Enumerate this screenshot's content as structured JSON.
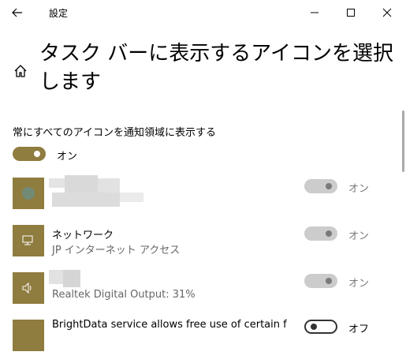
{
  "window": {
    "title": "設定"
  },
  "page": {
    "title": "タスク バーに表示するアイコンを選択します"
  },
  "always_show": {
    "label": "常にすべてのアイコンを通知領域に表示する",
    "toggle_state": "オン"
  },
  "apps": [
    {
      "icon": "app-blurred-icon",
      "name": "",
      "detail": "",
      "toggle_state": "オン",
      "toggle_on": true,
      "disabled": true
    },
    {
      "icon": "network-icon",
      "name": "ネットワーク",
      "detail": "JP インターネット アクセス",
      "toggle_state": "オン",
      "toggle_on": true,
      "disabled": true
    },
    {
      "icon": "volume-icon",
      "name": "",
      "detail": "Realtek Digital Output: 31%",
      "toggle_state": "オン",
      "toggle_on": true,
      "disabled": true
    },
    {
      "icon": "app-icon",
      "name": "BrightData service allows free use of certain f",
      "detail": "",
      "toggle_state": "オフ",
      "toggle_on": false,
      "disabled": false
    }
  ],
  "colors": {
    "accent": "#8f7c3f",
    "disabled_toggle": "#cccccc"
  }
}
